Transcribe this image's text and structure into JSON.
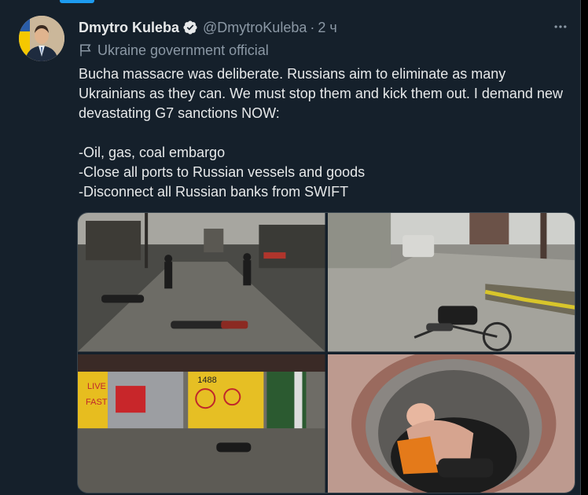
{
  "tweet": {
    "author_name": "Dmytro Kuleba",
    "handle": "@DmytroKuleba",
    "separator": "·",
    "time": "2 ч",
    "label": "Ukraine government official",
    "text_lines": [
      "Bucha massacre was deliberate. Russians aim to eliminate as many Ukrainians as they can. We must stop them and kick them out. I demand new devastating G7 sanctions NOW:",
      "",
      "-Oil, gas, coal embargo",
      "-Close all ports to Russian vessels and goods",
      "-Disconnect all Russian banks from SWIFT"
    ],
    "more_icon": "more-horizontal-icon",
    "verified_icon": "verified-badge-icon",
    "label_icon": "flag-icon"
  },
  "media": {
    "photos": [
      {
        "name": "photo-street-bodies"
      },
      {
        "name": "photo-bicycle-body"
      },
      {
        "name": "photo-graffiti-fence"
      },
      {
        "name": "photo-manhole"
      }
    ],
    "graffiti": {
      "sign_top": "1488",
      "live": "LIVE",
      "fast": "FAST"
    }
  },
  "colors": {
    "background": "#15202b",
    "text": "#e7e9ea",
    "secondary": "#8b98a5",
    "accent": "#1d9bf0"
  }
}
